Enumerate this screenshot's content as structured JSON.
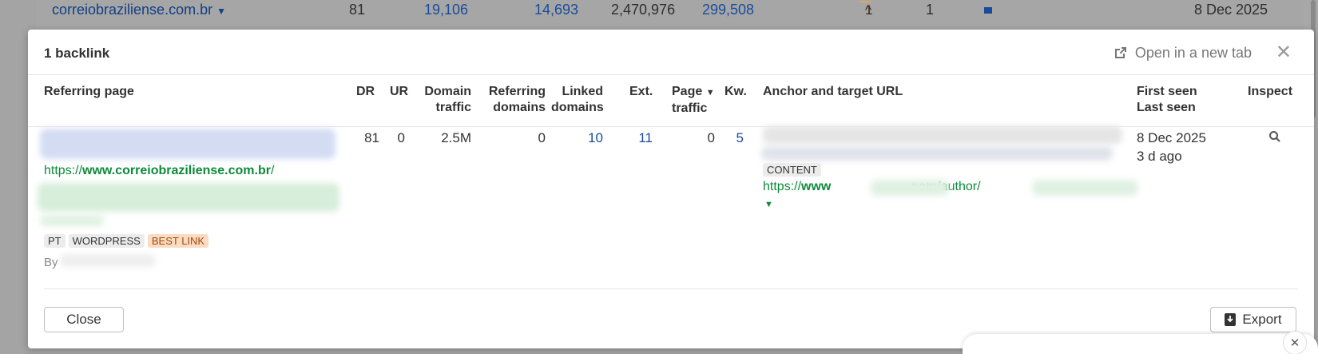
{
  "background_row": {
    "domain": "correiobraziliense.com.br",
    "dr": "81",
    "backlinks": "19,106",
    "ref_domains": "14,693",
    "traffic": "2,470,976",
    "value": "299,508",
    "count_badge": "1",
    "count": "1",
    "date": "8 Dec 2025"
  },
  "modal": {
    "title": "1 backlink",
    "open_new_tab": "Open in a new tab",
    "columns": {
      "referring_page": "Referring page",
      "dr": "DR",
      "ur": "UR",
      "domain_traffic": [
        "Domain",
        "traffic"
      ],
      "referring_domains": [
        "Referring",
        "domains"
      ],
      "linked_domains": [
        "Linked",
        "domains"
      ],
      "ext": "Ext.",
      "page_traffic": [
        "Page",
        "traffic"
      ],
      "kw": "Kw.",
      "anchor": "Anchor and target URL",
      "first_last": [
        "First seen",
        "Last seen"
      ],
      "inspect": "Inspect"
    },
    "row": {
      "url_prefix": "https://",
      "url_domain": "www.correiobraziliense.com.br",
      "url_suffix": "/",
      "tags": [
        "PT",
        "WORDPRESS",
        "BEST LINK"
      ],
      "by": "By",
      "dr": "81",
      "ur": "0",
      "domain_traffic": "2.5M",
      "referring_domains": "0",
      "linked_domains": "10",
      "ext": "11",
      "page_traffic": "0",
      "kw": "5",
      "anchor_tag": "CONTENT",
      "target_prefix": "https://",
      "target_www": "www",
      "target_com": "com",
      "target_path": "/author/",
      "first_seen": "8 Dec 2025",
      "last_seen": "3 d ago"
    },
    "close_button": "Close",
    "export_button": "Export"
  }
}
